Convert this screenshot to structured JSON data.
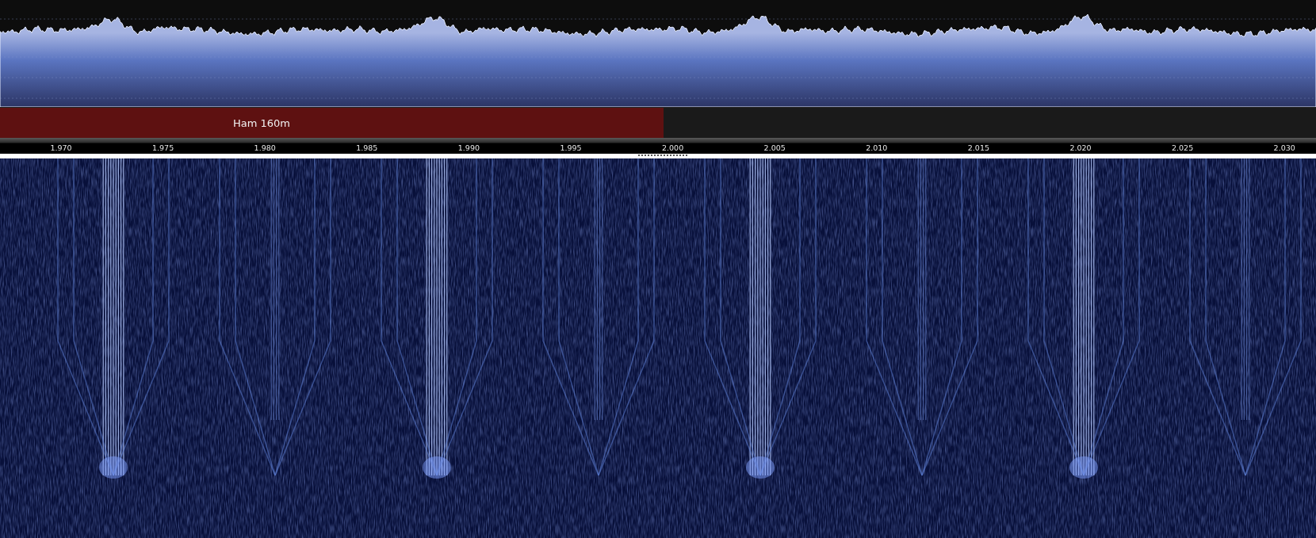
{
  "band_plan": {
    "label": "Ham 160m"
  },
  "frequency_axis": {
    "labels": [
      "1.970",
      "1.975",
      "1.980",
      "1.985",
      "1.990",
      "1.995",
      "2.000",
      "2.005",
      "2.010",
      "2.015",
      "2.020",
      "2.025",
      "2.030"
    ]
  }
}
